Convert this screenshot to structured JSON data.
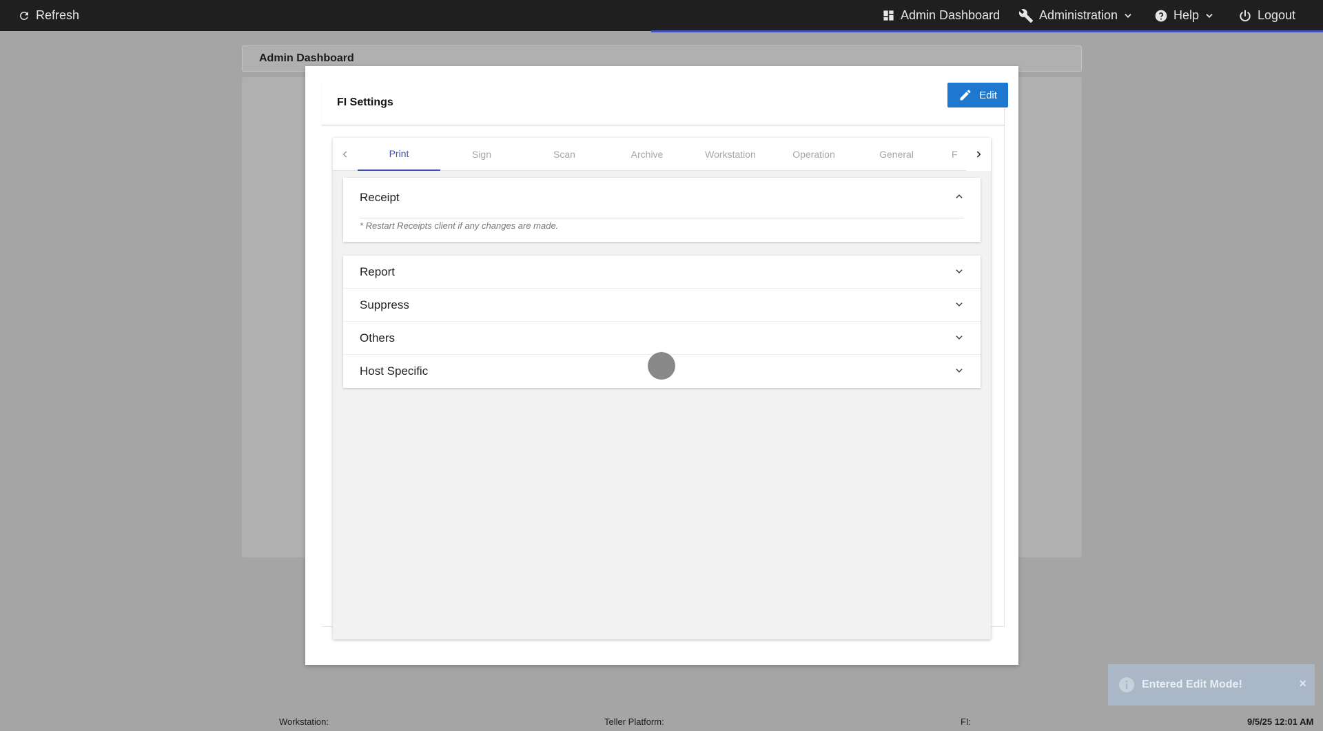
{
  "topbar": {
    "refresh": "Refresh",
    "admin_dashboard": "Admin Dashboard",
    "administration": "Administration",
    "help": "Help",
    "logout": "Logout"
  },
  "background": {
    "header_title": "Admin Dashboard"
  },
  "modal": {
    "title": "FI Settings",
    "edit_label": "Edit",
    "tabs": [
      "Print",
      "Sign",
      "Scan",
      "Archive",
      "Workstation",
      "Operation",
      "General",
      "F"
    ],
    "active_tab": "Print",
    "receipt": {
      "title": "Receipt",
      "note": "* Restart Receipts client if any changes are made."
    },
    "sections": [
      "Report",
      "Suppress",
      "Others",
      "Host Specific"
    ]
  },
  "toast": {
    "message": "Entered Edit Mode!",
    "close": "×"
  },
  "statusbar": {
    "workstation": "Workstation:",
    "teller_platform": "Teller Platform:",
    "fi": "FI:",
    "datetime": "9/5/25 12:01 AM"
  },
  "colors": {
    "accent": "#3f51b5",
    "edit_button": "#1f78cf",
    "topbar": "#1f1f1f",
    "toast": "#a9b7c7"
  },
  "icons": [
    "refresh-icon",
    "dashboard-icon",
    "wrench-icon",
    "help-icon",
    "power-icon",
    "chevron-down-icon",
    "pencil-icon",
    "chevron-left-icon",
    "chevron-right-icon",
    "chevron-up-icon",
    "info-icon",
    "close-icon"
  ]
}
